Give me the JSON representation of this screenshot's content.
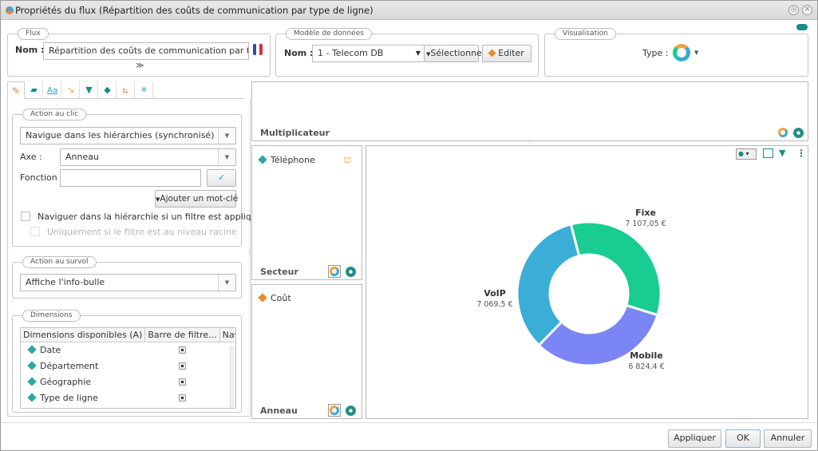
{
  "window": {
    "title": "Propriétés du flux (Répartition des coûts de communication par type de ligne)"
  },
  "flux": {
    "legend": "Flux",
    "name_label": "Nom :",
    "name_value": "Répartition des coûts de communication par type de"
  },
  "model": {
    "legend": "Modèle de données",
    "name_label": "Nom :",
    "selected": "1 - Telecom DB",
    "select_button": "Sélectionner",
    "edit_button": "Editer"
  },
  "visualisation": {
    "legend": "Visualisation",
    "type_label": "Type :"
  },
  "click_action": {
    "legend": "Action au clic",
    "action_selected": "Navigue dans les hiérarchies (synchronisé)",
    "axis_label": "Axe :",
    "axis_selected": "Anneau",
    "function_label": "Fonction :",
    "function_value": "",
    "add_keyword_button": "Ajouter un mot-clé",
    "nav_filter_label": "Naviguer dans la hiérarchie si un filtre est appliqué",
    "root_only_label": "Uniquement si le filtre est au niveau racine"
  },
  "hover_action": {
    "legend": "Action au survol",
    "selected": "Affiche l'info-bulle"
  },
  "dimensions": {
    "legend": "Dimensions",
    "headers": [
      "Dimensions disponibles (A)",
      "Barre de filtre...",
      "Naviga..."
    ],
    "rows": [
      {
        "name": "Date",
        "color": "#2aa7a0"
      },
      {
        "name": "Département",
        "color": "#2aa7a0"
      },
      {
        "name": "Géographie",
        "color": "#2aa7a0"
      },
      {
        "name": "Type de ligne",
        "color": "#2aa7a0"
      }
    ]
  },
  "zones": {
    "multiplier_label": "Multiplicateur",
    "sector_dimension": "Téléphone",
    "sector_label": "Secteur",
    "ring_measure": "Coût",
    "ring_label": "Anneau"
  },
  "chart_data": {
    "type": "pie",
    "title": "",
    "categories": [
      "Fixe",
      "Mobile",
      "VoIP"
    ],
    "values": [
      7107.05,
      6824.4,
      7069.5
    ],
    "value_labels": [
      "7 107,05 €",
      "6 824,4 €",
      "7 069,5 €"
    ],
    "colors": [
      "#19cc91",
      "#7b86f4",
      "#3aaed6"
    ],
    "donut": true
  },
  "footer": {
    "apply": "Appliquer",
    "ok": "OK",
    "cancel": "Annuler"
  },
  "colors": {
    "accent": "#1a8c83",
    "check_blue": "#2a9bd6"
  }
}
